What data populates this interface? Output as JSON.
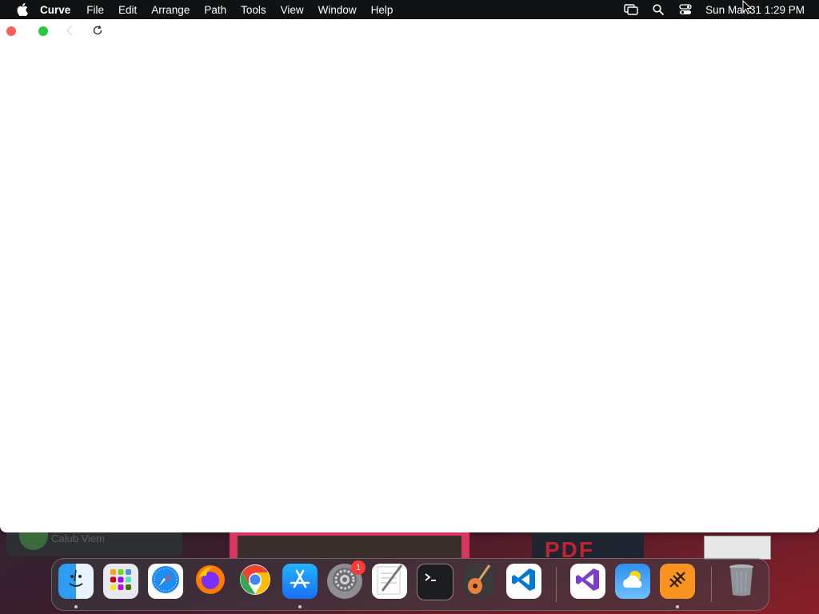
{
  "menubar": {
    "app_name": "Curve",
    "menus": [
      "File",
      "Edit",
      "Arrange",
      "Path",
      "Tools",
      "View",
      "Window",
      "Help"
    ],
    "clock": "Sun Mar 31  1:29 PM",
    "status_icons": [
      "screen-mirroring-icon",
      "search-icon",
      "control-center-icon"
    ]
  },
  "window": {
    "controls": [
      "close",
      "zoom"
    ],
    "toolbar": [
      "back-icon",
      "reload-icon"
    ]
  },
  "background": {
    "left_panel_text": "Calub Viem",
    "thumb_text": "PDF"
  },
  "dock": {
    "apps": [
      {
        "name": "Finder",
        "icon": "finder-icon",
        "running": true
      },
      {
        "name": "Launchpad",
        "icon": "launchpad-icon",
        "running": false
      },
      {
        "name": "Safari",
        "icon": "safari-icon",
        "running": false
      },
      {
        "name": "Firefox",
        "icon": "firefox-icon",
        "running": false
      },
      {
        "name": "Google Chrome",
        "icon": "chrome-icon",
        "running": false
      },
      {
        "name": "App Store",
        "icon": "app-store-icon",
        "running": true
      },
      {
        "name": "System Preferences",
        "icon": "system-preferences-icon",
        "running": false,
        "badge": "1"
      },
      {
        "name": "TextEdit",
        "icon": "textedit-icon",
        "running": false
      },
      {
        "name": "Terminal",
        "icon": "terminal-icon",
        "running": false
      },
      {
        "name": "GarageBand",
        "icon": "garageband-icon",
        "running": false
      },
      {
        "name": "Visual Studio Code",
        "icon": "vscode-icon",
        "running": false
      },
      {
        "name": "Visual Studio",
        "icon": "visual-studio-icon",
        "running": false
      },
      {
        "name": "Weather",
        "icon": "weather-icon",
        "running": false
      },
      {
        "name": "Curve",
        "icon": "curve-icon",
        "running": true
      },
      {
        "name": "Trash",
        "icon": "trash-icon",
        "running": false
      }
    ]
  }
}
